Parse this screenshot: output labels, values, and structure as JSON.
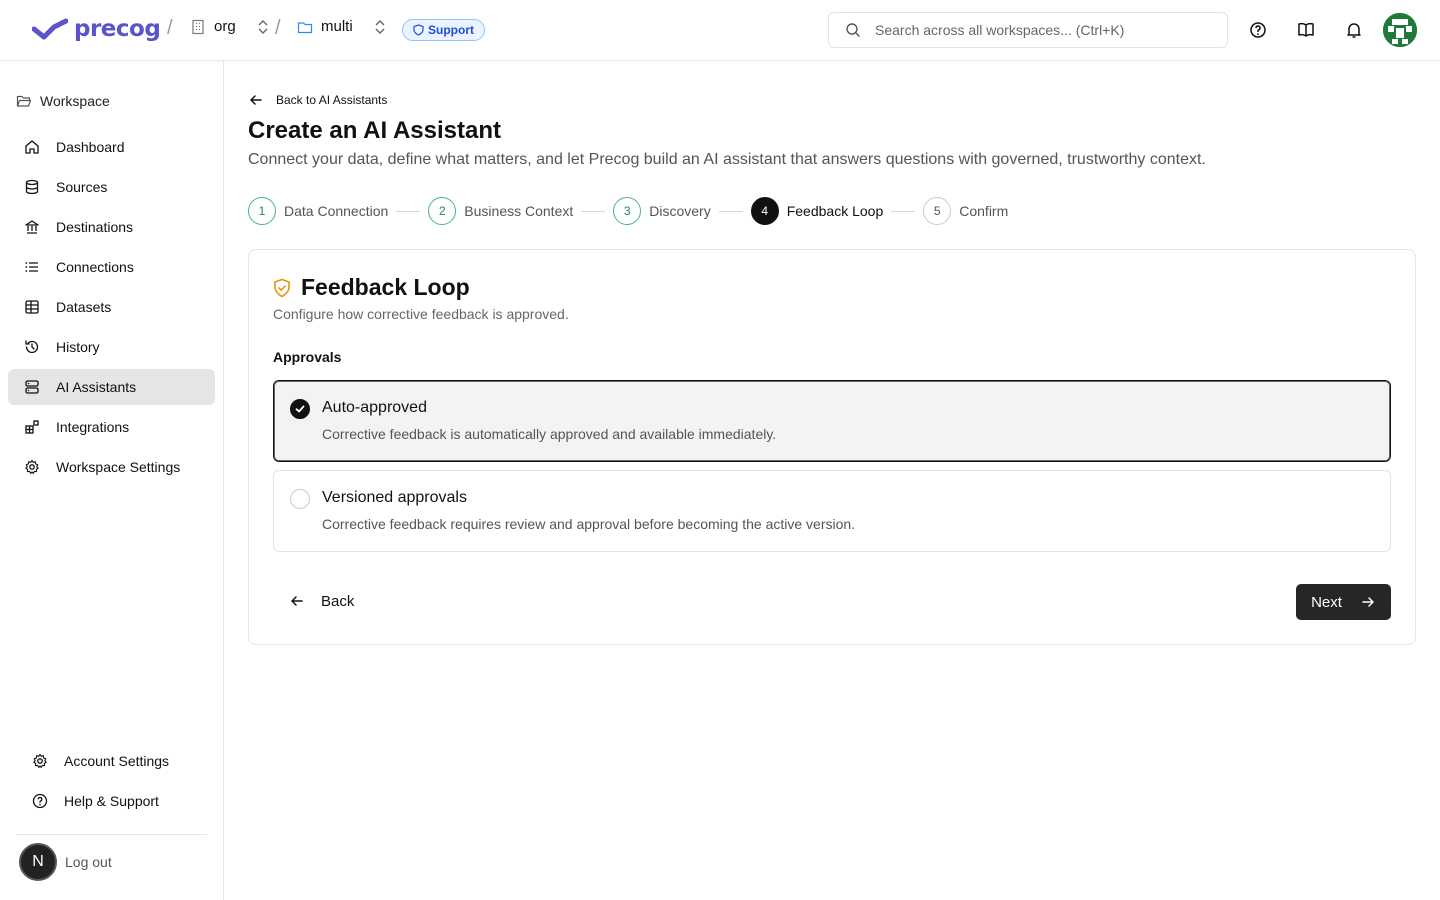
{
  "header": {
    "brand": "precog",
    "org_label": "org",
    "workspace_label": "multi",
    "support_badge": "Support",
    "search_placeholder": "Search across all workspaces... (Ctrl+K)",
    "icons": [
      "help-circle-icon",
      "book-open-icon",
      "bell-icon",
      "user-avatar"
    ],
    "colors": {
      "brand": "#5a53c9",
      "support_bg": "#eaf3ff",
      "support_text": "#1d4ed8"
    }
  },
  "sidebar": {
    "section_title": "Workspace",
    "items": [
      {
        "label": "Dashboard",
        "icon": "home-icon",
        "active": false
      },
      {
        "label": "Sources",
        "icon": "database-icon",
        "active": false
      },
      {
        "label": "Destinations",
        "icon": "landmark-icon",
        "active": false
      },
      {
        "label": "Connections",
        "icon": "list-icon",
        "active": false
      },
      {
        "label": "Datasets",
        "icon": "table-icon",
        "active": false
      },
      {
        "label": "History",
        "icon": "history-icon",
        "active": false
      },
      {
        "label": "AI Assistants",
        "icon": "server-icon",
        "active": true
      },
      {
        "label": "Integrations",
        "icon": "blocks-icon",
        "active": false
      },
      {
        "label": "Workspace Settings",
        "icon": "gear-icon",
        "active": false
      }
    ],
    "bottom_items": [
      {
        "label": "Account Settings",
        "icon": "gear-icon"
      },
      {
        "label": "Help & Support",
        "icon": "help-circle-icon"
      }
    ],
    "user_initial": "N",
    "logout_label": "Log out"
  },
  "main": {
    "back_link": "Back to AI Assistants",
    "title": "Create an AI Assistant",
    "subtitle": "Connect your data, define what matters, and let Precog build an AI assistant that answers questions with governed, trustworthy context.",
    "steps": [
      {
        "num": "1",
        "label": "Data Connection",
        "state": "done"
      },
      {
        "num": "2",
        "label": "Business Context",
        "state": "done"
      },
      {
        "num": "3",
        "label": "Discovery",
        "state": "done"
      },
      {
        "num": "4",
        "label": "Feedback Loop",
        "state": "current"
      },
      {
        "num": "5",
        "label": "Confirm",
        "state": "pending"
      }
    ],
    "card": {
      "title": "Feedback Loop",
      "description": "Configure how corrective feedback is approved.",
      "approvals_label": "Approvals",
      "options": [
        {
          "title": "Auto-approved",
          "description": "Corrective feedback is automatically approved and available immediately.",
          "selected": true
        },
        {
          "title": "Versioned approvals",
          "description": "Corrective feedback requires review and approval before becoming the active version.",
          "selected": false
        }
      ],
      "back_label": "Back",
      "next_label": "Next"
    }
  }
}
